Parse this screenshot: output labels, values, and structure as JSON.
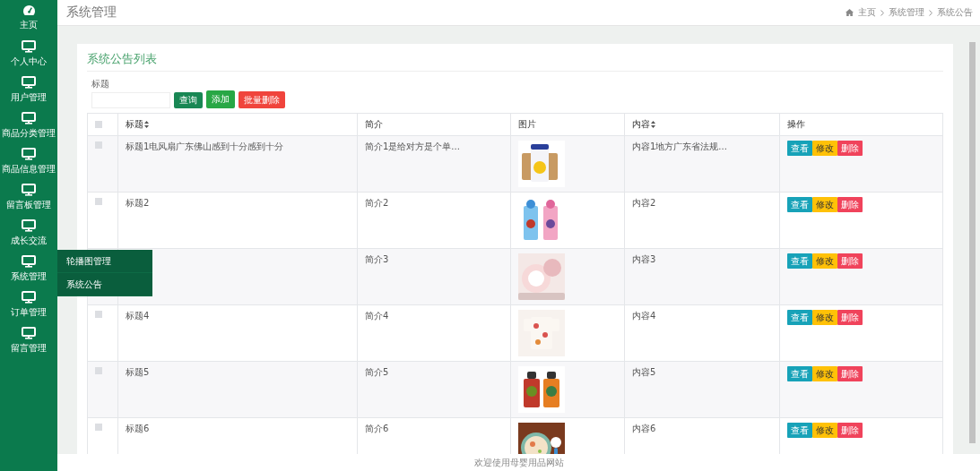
{
  "sidebar": {
    "items": [
      {
        "label": "主页"
      },
      {
        "label": "个人中心"
      },
      {
        "label": "用户管理"
      },
      {
        "label": "商品分类管理"
      },
      {
        "label": "商品信息管理"
      },
      {
        "label": "留言板管理"
      },
      {
        "label": "成长交流"
      },
      {
        "label": "系统管理",
        "children": [
          {
            "label": "轮播图管理"
          },
          {
            "label": "系统公告"
          }
        ]
      },
      {
        "label": "订单管理"
      },
      {
        "label": "留言管理"
      }
    ]
  },
  "header": {
    "title": "系统管理",
    "breadcrumb": [
      "主页",
      "系统管理",
      "系统公告"
    ]
  },
  "card": {
    "title": "系统公告列表",
    "search": {
      "label": "标题"
    },
    "buttons": [
      {
        "label": "查询",
        "kind": "search"
      },
      {
        "label": "添加",
        "kind": "add"
      },
      {
        "label": "批量删除",
        "kind": "delete"
      }
    ],
    "table": {
      "select_all_checked": false,
      "columns": [
        "标题",
        "简介",
        "图片",
        "内容",
        "操作"
      ],
      "rows": [
        {
          "checked": false,
          "title": "标题1电风扇广东佛山感到十分感到十分",
          "intro": "简介1是给对方是个单...",
          "content": "内容1地方广东省法规...",
          "actions": [
            "查看",
            "修改",
            "删除"
          ]
        },
        {
          "checked": false,
          "title": "标题2",
          "intro": "简介2",
          "content": "内容2",
          "actions": [
            "查看",
            "修改",
            "删除"
          ]
        },
        {
          "intro": "简介3",
          "content": "内容3",
          "actions": [
            "查看",
            "修改",
            "删除"
          ]
        },
        {
          "checked": false,
          "title": "标题4",
          "intro": "简介4",
          "content": "内容4",
          "actions": [
            "查看",
            "修改",
            "删除"
          ]
        },
        {
          "checked": false,
          "title": "标题5",
          "intro": "简介5",
          "content": "内容5",
          "actions": [
            "查看",
            "修改",
            "删除"
          ]
        },
        {
          "checked": false,
          "title": "标题6",
          "intro": "简介6",
          "content": "内容6",
          "actions": [
            "查看",
            "修改",
            "删除"
          ]
        }
      ]
    }
  },
  "footer": "欢迎使用母婴用品网站"
}
